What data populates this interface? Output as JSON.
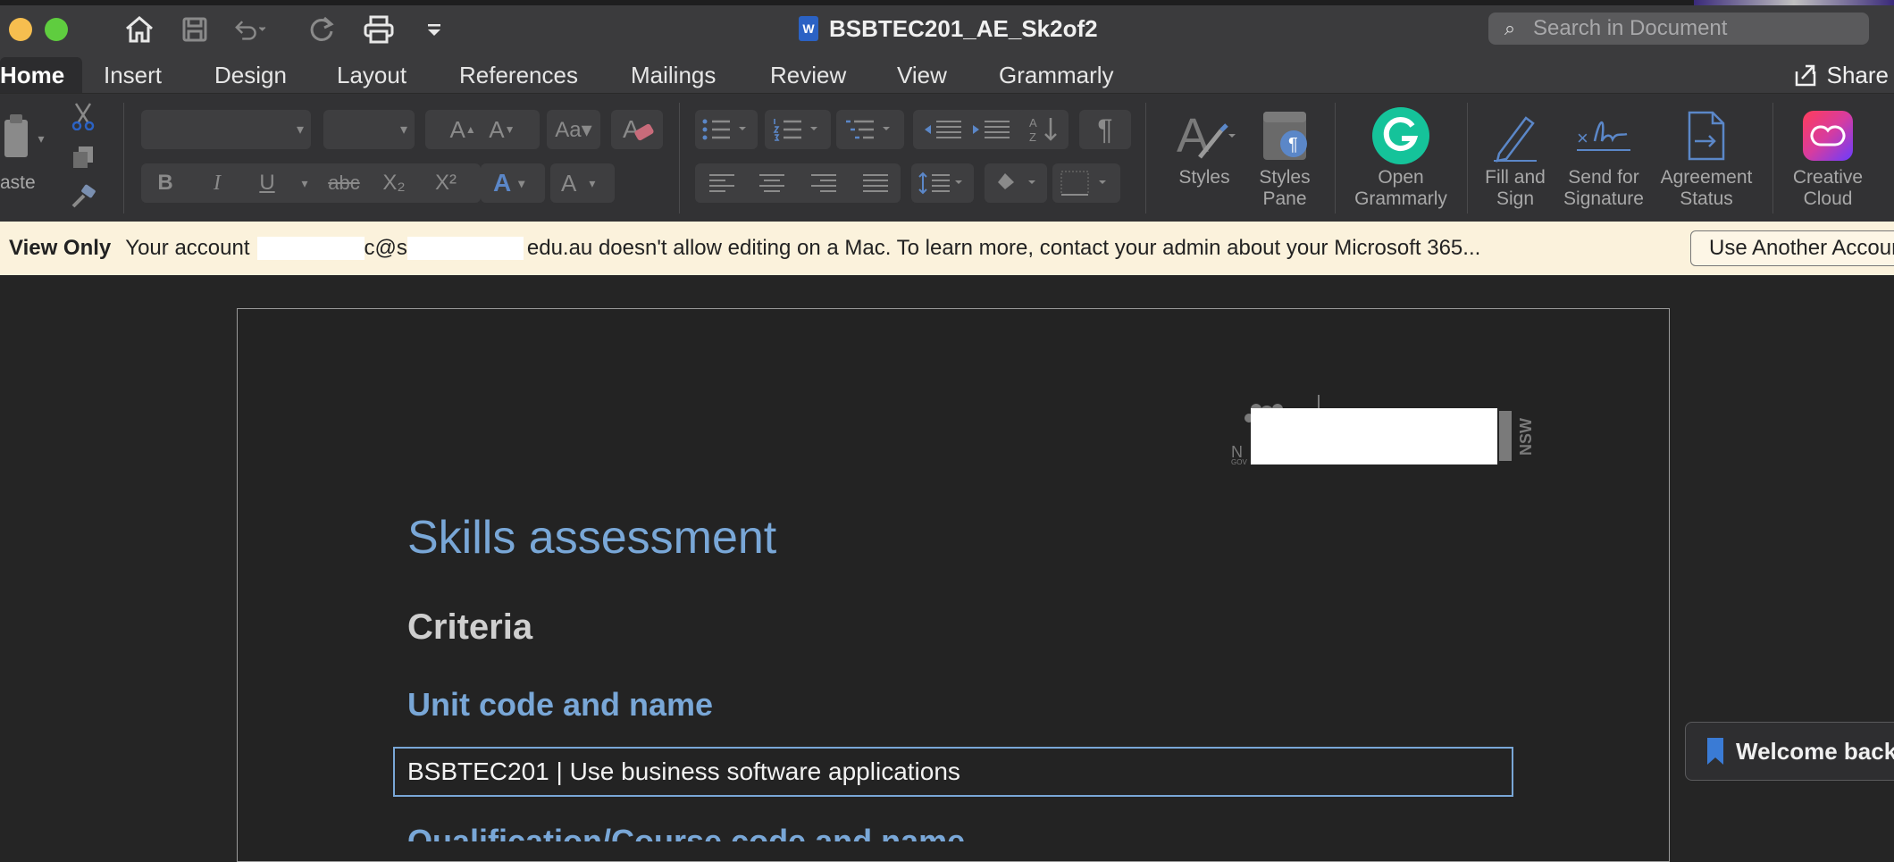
{
  "window": {
    "title": "BSBTEC201_AE_Sk2of2",
    "search_placeholder": "Search in Document",
    "share_label": "Share"
  },
  "tabs": [
    {
      "label": "Home",
      "active": true
    },
    {
      "label": "Insert"
    },
    {
      "label": "Design"
    },
    {
      "label": "Layout"
    },
    {
      "label": "References"
    },
    {
      "label": "Mailings"
    },
    {
      "label": "Review"
    },
    {
      "label": "View"
    },
    {
      "label": "Grammarly"
    }
  ],
  "ribbon": {
    "paste_label": "aste",
    "styles_label": "Styles",
    "styles_pane_label": [
      "Styles",
      "Pane"
    ],
    "open_grammarly_label": [
      "Open",
      "Grammarly"
    ],
    "fill_sign_label": [
      "Fill and",
      "Sign"
    ],
    "send_signature_label": [
      "Send for",
      "Signature"
    ],
    "agreement_status_label": [
      "Agreement",
      "Status"
    ],
    "creative_cloud_label": [
      "Creative",
      "Cloud"
    ],
    "bold": "B",
    "italic": "I",
    "underline": "U",
    "strike": "abc",
    "subscript": "X₂",
    "superscript": "X²",
    "font_color": "A",
    "highlight": "A",
    "pilcrow": "¶"
  },
  "notice": {
    "title": "View Only",
    "text_before": "Your account",
    "text_mid": "c@s",
    "text_mid2": "edu.au doesn't allow editing on a Mac. To learn more, contact your admin about your Microsoft 365...",
    "button": "Use Another Account"
  },
  "document": {
    "title": "Skills assessment",
    "criteria": "Criteria",
    "unit_heading": "Unit code and name",
    "unit_value": "BSBTEC201 | Use business software applications",
    "qualification_heading": "Qualification/Course code and name",
    "logo_text": "NSW"
  },
  "welcome": {
    "label": "Welcome back"
  },
  "colors": {
    "accent_blue": "#79a7d7",
    "grammarly_green": "#15c39a",
    "notice_bg": "#fbf2dc"
  }
}
